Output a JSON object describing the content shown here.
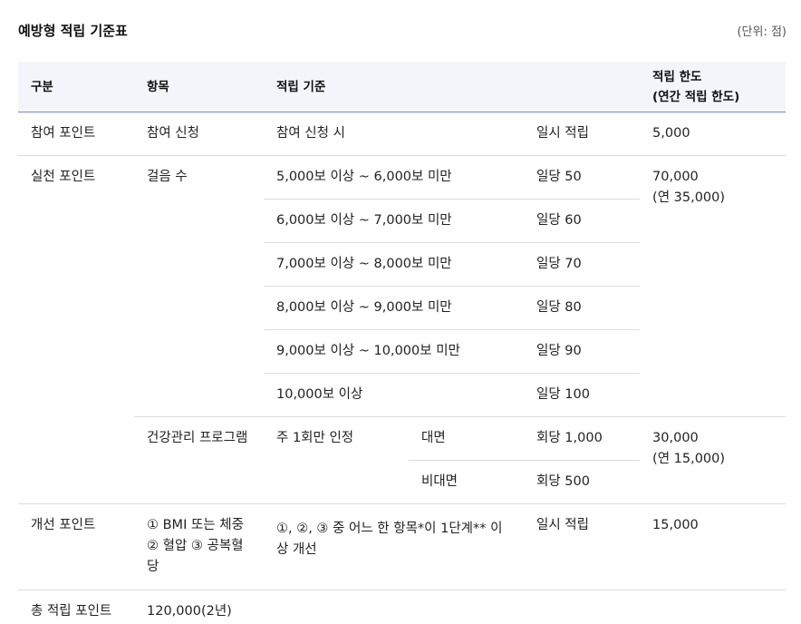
{
  "title": "예방형 적립 기준표",
  "unit_note": "(단위: 점)",
  "headers": {
    "category": "구분",
    "item": "항목",
    "criteria": "적립 기준",
    "limit_line1": "적립 한도",
    "limit_line2": "(연간 적립 한도)"
  },
  "rows": {
    "participation": {
      "category": "참여 포인트",
      "item": "참여 신청",
      "criteria": "참여 신청 시",
      "points": "일시 적립",
      "limit": "5,000"
    },
    "practice": {
      "category": "실천 포인트",
      "walking": {
        "item": "걸음 수",
        "tiers": [
          {
            "criteria": "5,000보 이상 ~ 6,000보 미만",
            "points": "일당 50"
          },
          {
            "criteria": "6,000보 이상 ~ 7,000보 미만",
            "points": "일당 60"
          },
          {
            "criteria": "7,000보 이상 ~ 8,000보 미만",
            "points": "일당 70"
          },
          {
            "criteria": "8,000보 이상 ~ 9,000보 미만",
            "points": "일당 80"
          },
          {
            "criteria": "9,000보 이상 ~ 10,000보 미만",
            "points": "일당 90"
          },
          {
            "criteria": "10,000보 이상",
            "points": "일당 100"
          }
        ],
        "limit": "70,000",
        "limit_annual": "(연 35,000)"
      },
      "program": {
        "item": "건강관리 프로그램",
        "criteria": "주 1회만 인정",
        "in_person": {
          "mode": "대면",
          "points": "회당 1,000"
        },
        "remote": {
          "mode": "비대면",
          "points": "회당 500"
        },
        "limit": "30,000",
        "limit_annual": "(연 15,000)"
      }
    },
    "improvement": {
      "category": "개선 포인트",
      "item": "① BMI 또는 체중 ② 혈압 ③ 공복혈당",
      "criteria": "①, ②, ③ 중 어느 한 항목*이 1단계** 이상 개선",
      "points": "일시 적립",
      "limit": "15,000"
    },
    "total": {
      "category": "총 적립 포인트",
      "value": "120,000(2년)"
    }
  }
}
